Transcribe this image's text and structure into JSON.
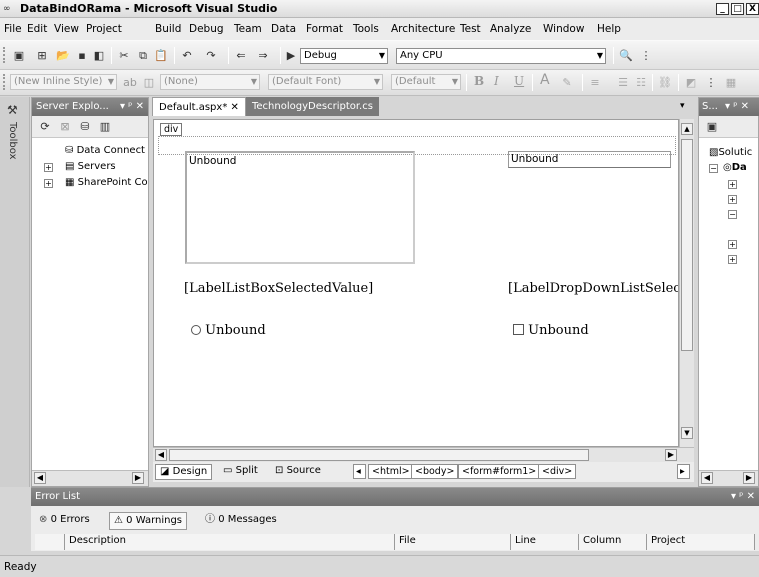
{
  "window": {
    "title": "DataBindORama - Microsoft Visual Studio",
    "controls": [
      "_",
      "□",
      "X"
    ]
  },
  "menu": [
    "File",
    "Edit",
    "View",
    "Project",
    "Build",
    "Debug",
    "Team",
    "Data",
    "Format",
    "Tools",
    "Architecture",
    "Test",
    "Analyze",
    "Window",
    "Help"
  ],
  "toolbar1": {
    "config": "Debug",
    "platform": "Any CPU"
  },
  "toolbar2": {
    "style": "(New Inline Style)",
    "block": "(None)",
    "font": "(Default Font)",
    "size": "(Default",
    "bold": "B",
    "italic": "I",
    "underline": "U",
    "fontcolor": "A"
  },
  "left_strip": {
    "label": "Toolbox"
  },
  "server_explorer": {
    "title": "Server Explo...",
    "pin": "▾ ᵖ ✕",
    "items": [
      "Data Connect",
      "Servers",
      "SharePoint Co"
    ]
  },
  "editor": {
    "tabs": [
      "Default.aspx*",
      "TechnologyDescriptor.cs"
    ],
    "tag": "div",
    "listbox_text": "Unbound",
    "dropdown_text": "Unbound",
    "label_listbox": "[LabelListBoxSelectedValue]",
    "label_dropdown": "[LabelDropDownListSelectec",
    "radio_text": "Unbound",
    "checkbox_text": "Unbound",
    "views": [
      "Design",
      "Split",
      "Source"
    ],
    "crumbs": [
      "<html>",
      "<body>",
      "<form#form1>",
      "<div>"
    ]
  },
  "solution": {
    "title": "S...",
    "pin": "▾ ᵖ ✕",
    "item": "Solutic",
    "item2": "Da"
  },
  "errorlist": {
    "title": "Error List",
    "pin": "▾ ᵖ ✕",
    "errors": "0 Errors",
    "warnings": "0 Warnings",
    "messages": "0 Messages",
    "columns": [
      "Description",
      "File",
      "Line",
      "Column",
      "Project"
    ]
  },
  "status": {
    "text": "Ready"
  }
}
